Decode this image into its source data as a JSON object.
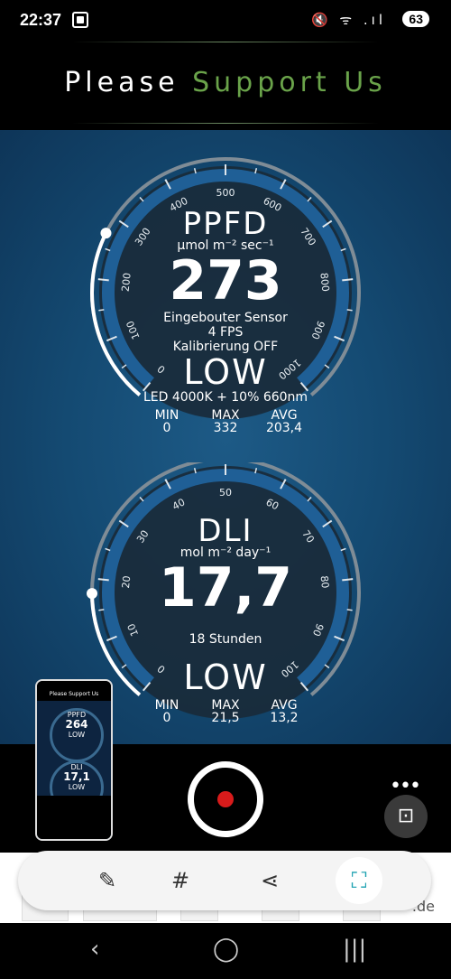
{
  "status_bar": {
    "time": "22:37",
    "signal_icons": "🔇 ᯤ .ıl",
    "battery": "63"
  },
  "header": {
    "title_part1": "Please",
    "title_part2": "Support Us"
  },
  "ppfd_gauge": {
    "title": "PPFD",
    "unit": "µmol m⁻² sec⁻¹",
    "value": "273",
    "line1": "Eingebouter Sensor",
    "line2": "4 FPS",
    "line3": "Kalibrierung OFF",
    "level": "LOW",
    "light_source": "LED 4000K + 10% 660nm",
    "stats": {
      "min_label": "MIN",
      "min": "0",
      "max_label": "MAX",
      "max": "332",
      "avg_label": "AVG",
      "avg": "203,4"
    },
    "scale_max": 1000,
    "current": 273,
    "ticks": [
      "0",
      "100",
      "200",
      "300",
      "400",
      "500",
      "600",
      "700",
      "800",
      "900",
      "1000"
    ]
  },
  "dli_gauge": {
    "title": "DLI",
    "unit": "mol m⁻² day⁻¹",
    "value": "17,7",
    "line1": "18 Stunden",
    "level": "LOW",
    "stats": {
      "min_label": "MIN",
      "min": "0",
      "max_label": "MAX",
      "max": "21,5",
      "avg_label": "AVG",
      "avg": "13,2"
    },
    "scale_max": 100,
    "current": 17.7,
    "ticks": [
      "0",
      "10",
      "20",
      "30",
      "40",
      "50",
      "60",
      "70",
      "80",
      "90",
      "100"
    ]
  },
  "thumbnail": {
    "title": "Please Support Us",
    "ppfd_label": "PPFD",
    "ppfd_value": "264",
    "ppfd_level": "LOW",
    "dli_label": "DLI",
    "dli_value": "17,1",
    "dli_level": "LOW"
  },
  "toolbar": {
    "edit_icon": "edit-icon",
    "hash_icon": "hashtag-icon",
    "share_icon": "share-icon",
    "scan_icon": "scan-icon"
  },
  "ads": {
    "tail_text": ".de"
  },
  "nav": {
    "back": "back-icon",
    "home": "home-icon",
    "recents": "recents-icon"
  }
}
